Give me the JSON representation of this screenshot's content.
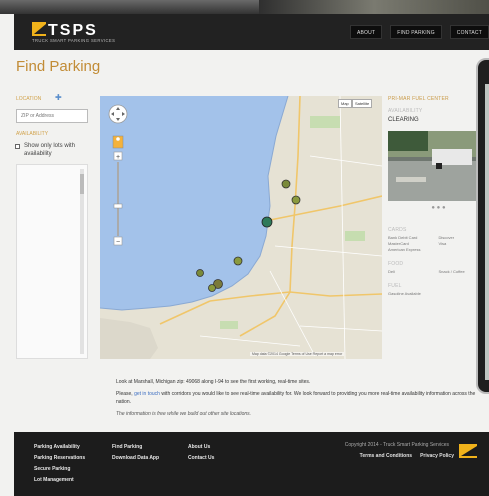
{
  "colors": {
    "accent": "#c28c36",
    "link": "#3d6ec1",
    "header": "#222222",
    "logo_yellow": "#f0b21b"
  },
  "header": {
    "logo_text": "TSPS",
    "logo_tagline": "TRUCK SMART PARKING SERVICES",
    "nav": [
      {
        "label": "ABOUT"
      },
      {
        "label": "FIND PARKING"
      },
      {
        "label": "CONTACT"
      }
    ]
  },
  "page": {
    "title": "Find Parking"
  },
  "location": {
    "label": "LOCATION",
    "zip_placeholder": "ZIP or Address"
  },
  "availability": {
    "label": "AVAILABILITY",
    "checkbox_label": "Show only lots with availability"
  },
  "map": {
    "map_label": "Map",
    "satellite_label": "Satellite",
    "attribution": "Map data ©2014 Google   Terms of Use   Report a map error"
  },
  "panel": {
    "name": "PRI-MAR FUEL CENTER",
    "availability_label": "AVAILABILITY",
    "status": "CLEARING",
    "cards_label": "CARDS",
    "cards": [
      "Bank Debit Card",
      "Discover",
      "MasterCard",
      "Visa",
      "American Express"
    ],
    "food_label": "FOOD",
    "food": [
      "Deli",
      "Snack / Coffee"
    ],
    "fuel_label": "FUEL",
    "fuel": [
      "Gasoline Available"
    ]
  },
  "caption": {
    "p1": "Look at Marshall, Michigan zip: 49068 along I-94 to see the first working, real-time sites.",
    "p2_pre": "Please,",
    "p2_link": "get in touch",
    "p2_post": "with corridors you would like to see real-time availability for. We look forward to providing you more real-time availability information across the nation.",
    "p3": "The information is free while we build out other site locations."
  },
  "footer": {
    "col1": [
      "Parking Availability",
      "Parking Reservations",
      "Secure Parking",
      "Lot Management"
    ],
    "col2": [
      "Find Parking",
      "Download Data App"
    ],
    "col3": [
      "About Us",
      "Contact Us"
    ],
    "copyright": "Copyright 2014 - Truck Smart Parking Services",
    "terms": "Terms and Conditions",
    "privacy": "Privacy Policy"
  }
}
